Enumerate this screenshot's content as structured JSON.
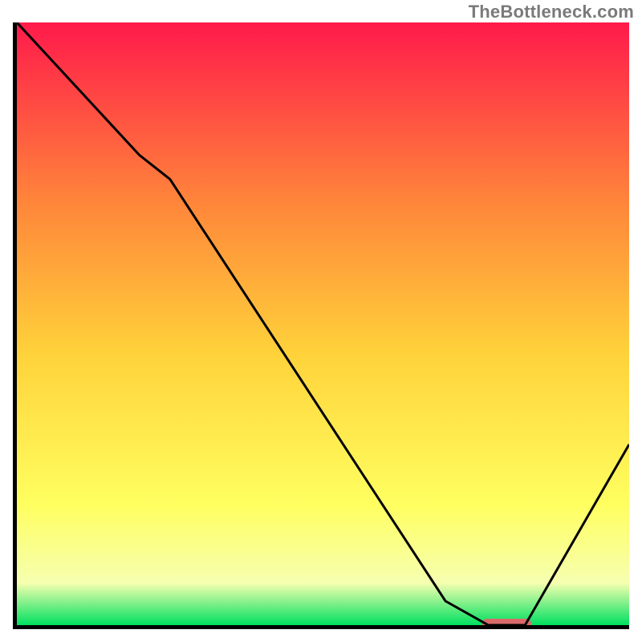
{
  "attribution": "TheBottleneck.com",
  "colors": {
    "gradient_top": "#ff1a4b",
    "gradient_upper_mid": "#ff863a",
    "gradient_mid": "#ffd23a",
    "gradient_lower_mid": "#ffff60",
    "gradient_low": "#f6ffb0",
    "gradient_bottom": "#00e060",
    "curve": "#000000",
    "marker": "#d86a6a"
  },
  "chart_data": {
    "type": "line",
    "title": "",
    "xlabel": "",
    "ylabel": "",
    "xlim": [
      0,
      100
    ],
    "ylim": [
      0,
      100
    ],
    "x": [
      0,
      20,
      25,
      70,
      77,
      83,
      100
    ],
    "values": [
      100,
      78,
      74,
      4,
      0,
      0,
      30
    ],
    "marker": {
      "x_start": 76,
      "x_end": 84,
      "y": 0
    },
    "annotations": []
  }
}
